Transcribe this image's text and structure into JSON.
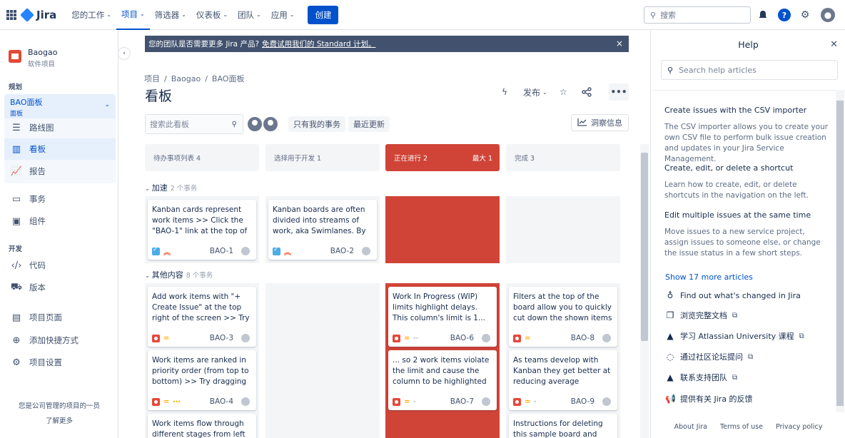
{
  "topnav": {
    "logo": "Jira",
    "items": [
      {
        "label": "您的工作",
        "active": false
      },
      {
        "label": "项目",
        "active": true
      },
      {
        "label": "筛选器",
        "active": false
      },
      {
        "label": "仪表板",
        "active": false
      },
      {
        "label": "团队",
        "active": false
      },
      {
        "label": "应用",
        "active": false
      }
    ],
    "create": "创建",
    "search_placeholder": "搜索"
  },
  "sidebar": {
    "project_name": "Baogao",
    "project_type": "软件项目",
    "planning_label": "规划",
    "board_name": "BAO面板",
    "board_sub": "面板",
    "plan_items": [
      {
        "label": "路线图",
        "icon": "roadmap-icon"
      },
      {
        "label": "看板",
        "icon": "board-icon",
        "active": true
      },
      {
        "label": "报告",
        "icon": "reports-icon"
      }
    ],
    "items2": [
      {
        "label": "事务",
        "icon": "issues-icon"
      },
      {
        "label": "组件",
        "icon": "components-icon"
      }
    ],
    "dev_label": "开发",
    "dev_items": [
      {
        "label": "代码",
        "icon": "code-icon"
      },
      {
        "label": "版本",
        "icon": "releases-icon"
      }
    ],
    "items3": [
      {
        "label": "项目页面",
        "icon": "pages-icon"
      },
      {
        "label": "添加快捷方式",
        "icon": "add-shortcut-icon"
      },
      {
        "label": "项目设置",
        "icon": "settings-icon"
      }
    ],
    "footer_text": "您是公司管理的项目的一员",
    "footer_link": "了解更多"
  },
  "banner": {
    "text": "您的团队是否需要更多 Jira 产品?",
    "link": "免费试用我们的 Standard 计划。",
    "close": "×"
  },
  "breadcrumbs": [
    "项目",
    "Baogao",
    "BAO面板"
  ],
  "page_title": "看板",
  "actions": {
    "release": "发布"
  },
  "toolbar": {
    "search_placeholder": "搜索此看板",
    "only_my": "只有我的事务",
    "recent": "最近更新",
    "insights": "洞察信息"
  },
  "columns": [
    {
      "label": "待办事项列表 4",
      "max": "",
      "over": false
    },
    {
      "label": "选择用于开发 1",
      "max": "",
      "over": false
    },
    {
      "label": "正在进行 2",
      "max": "最大 1",
      "over": true
    },
    {
      "label": "完成 3",
      "max": "",
      "over": false
    }
  ],
  "swimlanes": [
    {
      "name": "加速",
      "count": "2 个事务"
    },
    {
      "name": "其他内容",
      "count": "8 个事务"
    }
  ],
  "cards": {
    "bao1": {
      "text": "Kanban cards represent work items >> Click the \"BAO-1\" link at the top of this card to",
      "key": "BAO-1"
    },
    "bao2": {
      "text": "Kanban boards are often divided into streams of work, aka Swimlanes. By default,",
      "key": "BAO-2"
    },
    "bao3": {
      "text": "Add work items with \"+ Create Issue\" at the top right of the screen >> Try adding a",
      "key": "BAO-3"
    },
    "bao4": {
      "text": "Work items are ranked in priority order (from top to bottom) >> Try dragging this",
      "key": "BAO-4"
    },
    "bao5": {
      "text": "Work items flow through different stages from left to",
      "key": ""
    },
    "bao6": {
      "text": "Work In Progress (WIP) limits highlight delays. This column's limit is 1...",
      "key": "BAO-6"
    },
    "bao7": {
      "text": "... so 2 work items violate the limit and cause the column to be highlighted",
      "key": "BAO-7"
    },
    "bao8": {
      "text": "Filters at the top of the board allow you to quickly cut down the shown items >> Try",
      "key": "BAO-8"
    },
    "bao9": {
      "text": "As teams develop with Kanban they get better at reducing average resolution",
      "key": "BAO-9"
    },
    "bao10": {
      "text": "Instructions for deleting this sample board and project are",
      "key": ""
    }
  },
  "help": {
    "title": "Help",
    "search_placeholder": "Search help articles",
    "articles": [
      {
        "title": "Create issues with the CSV importer",
        "desc": "The CSV importer allows you to create your own CSV file to perform bulk issue creation and updates in your Jira Service Management."
      },
      {
        "title": "Create, edit, or delete a shortcut",
        "desc": "Learn how to create, edit, or delete shortcuts in the navigation on the left."
      },
      {
        "title": "Edit multiple issues at the same time",
        "desc": "Move issues to a new service project, assign issues to someone else, or change the issue status in a few short steps."
      }
    ],
    "show_more": "Show 17 more articles",
    "links": [
      {
        "label": "Find out what's changed in Jira",
        "icon": "lightbulb-icon",
        "ext": false
      },
      {
        "label": "浏览完整文档",
        "icon": "docs-icon",
        "ext": true
      },
      {
        "label": "学习 Atlassian University 课程",
        "icon": "atlassian-icon",
        "ext": true
      },
      {
        "label": "通过社区论坛提问",
        "icon": "community-icon",
        "ext": true
      },
      {
        "label": "联系支持团队",
        "icon": "support-icon",
        "ext": true
      },
      {
        "label": "提供有关 Jira 的反馈",
        "icon": "feedback-icon",
        "ext": false
      }
    ],
    "footer": [
      "About Jira",
      "Terms of use",
      "Privacy policy"
    ]
  },
  "colors": {
    "brand": "#0052cc",
    "over_limit": "#d04437",
    "banner": "#42526e"
  }
}
